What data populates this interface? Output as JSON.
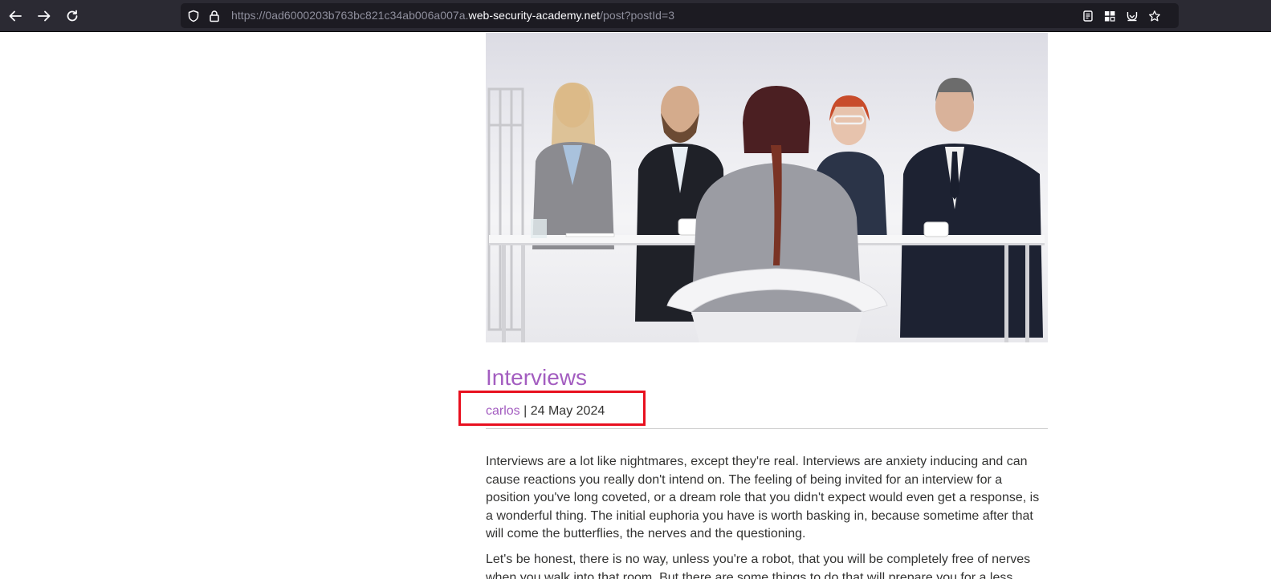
{
  "browser": {
    "url_prefix": "https://0ad6000203b763bc821c34ab006a007a.",
    "url_domain": "web-security-academy.net",
    "url_path": "/post?postId=3"
  },
  "post": {
    "title": "Interviews",
    "author": "carlos",
    "separator": " | ",
    "date": "24 May 2024",
    "paragraphs": [
      "Interviews are a lot like nightmares, except they're real. Interviews are anxiety inducing and can cause reactions you really don't intend on. The feeling of being invited for an interview for a position you've long coveted, or a dream role that you didn't expect would even get a response, is a wonderful thing. The initial euphoria you have is worth basking in, because sometime after that will come the butterflies, the nerves and the questioning.",
      "Let's be honest, there is no way, unless you're a robot, that you will be completely free of nerves when you walk into that room. But there are some things to do that will prepare you for a less"
    ]
  },
  "colors": {
    "toolbar_bg": "#2b2a33",
    "link_purple": "#a35dc0",
    "highlight_red": "#e8101f",
    "body_text": "#333332"
  }
}
